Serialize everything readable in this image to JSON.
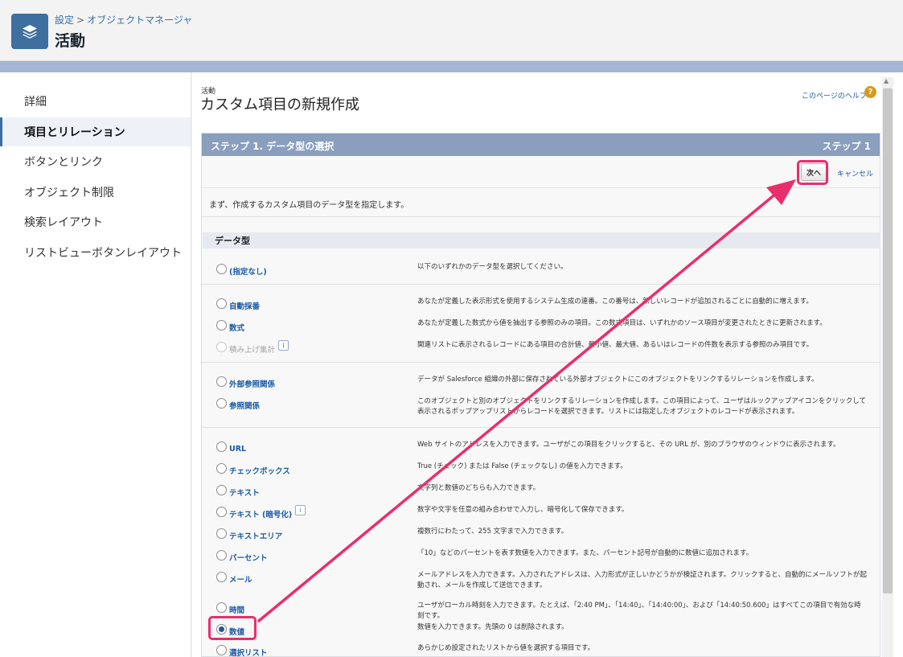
{
  "header": {
    "breadcrumb": [
      "設定",
      "オブジェクトマネージャ"
    ],
    "breadcrumb_separator": ">",
    "title": "活動",
    "icon": "layers-icon"
  },
  "sidebar": {
    "items": [
      {
        "label": "詳細",
        "active": false
      },
      {
        "label": "項目とリレーション",
        "active": true
      },
      {
        "label": "ボタンとリンク",
        "active": false
      },
      {
        "label": "オブジェクト制限",
        "active": false
      },
      {
        "label": "検索レイアウト",
        "active": false
      },
      {
        "label": "リストビューボタンレイアウト",
        "active": false
      }
    ]
  },
  "main": {
    "object_label": "活動",
    "page_title": "カスタム項目の新規作成",
    "help_link": "このページのヘルプ",
    "help_icon": "?",
    "step_title": "ステップ 1. データ型の選択",
    "step_number": "ステップ 1",
    "next_button": "次へ",
    "cancel_link": "キャンセル",
    "intro_text": "まず、作成するカスタム項目のデータ型を指定します。",
    "section_title": "データ型",
    "info_icon_label": "i",
    "options": [
      {
        "label": "(指定なし)",
        "description": "以下のいずれかのデータ型を選択してください。",
        "selected": false,
        "disabled": false,
        "info": false
      },
      {
        "label": "自動採番",
        "description": "あなたが定義した表示形式を使用するシステム生成の連番。この番号は、新しいレコードが追加されるごとに自動的に増えます。",
        "selected": false,
        "disabled": false,
        "info": false
      },
      {
        "label": "数式",
        "description": "あなたが定義した数式から値を抽出する参照のみの項目。この数式項目は、いずれかのソース項目が変更されたときに更新されます。",
        "selected": false,
        "disabled": false,
        "info": false
      },
      {
        "label": "積み上げ集計",
        "description": "関連リストに表示されるレコードにある項目の合計値、最小値、最大値、あるいはレコードの件数を表示する参照のみ項目です。",
        "selected": false,
        "disabled": true,
        "info": true
      },
      {
        "label": "外部参照関係",
        "description": "データが Salesforce 組織の外部に保存されている外部オブジェクトにこのオブジェクトをリンクするリレーションを作成します。",
        "selected": false,
        "disabled": false,
        "info": false
      },
      {
        "label": "参照関係",
        "description": "このオブジェクトと別のオブジェクトをリンクするリレーションを作成します。この項目によって、ユーザはルックアップアイコンをクリックして表示されるポップアップリストからレコードを選択できます。リストには指定したオブジェクトのレコードが表示されます。",
        "selected": false,
        "disabled": false,
        "info": false
      },
      {
        "label": "URL",
        "description": "Web サイトのアドレスを入力できます。ユーザがこの項目をクリックすると、その URL が、別のブラウザのウィンドウに表示されます。",
        "selected": false,
        "disabled": false,
        "info": false
      },
      {
        "label": "チェックボックス",
        "description": "True (チェック) または False (チェックなし) の値を入力できます。",
        "selected": false,
        "disabled": false,
        "info": false
      },
      {
        "label": "テキスト",
        "description": "文字列と数値のどちらも入力できます。",
        "selected": false,
        "disabled": false,
        "info": false
      },
      {
        "label": "テキスト (暗号化)",
        "description": "数字や文字を任意の組み合わせで入力し、暗号化して保存できます。",
        "selected": false,
        "disabled": false,
        "info": true
      },
      {
        "label": "テキストエリア",
        "description": "複数行にわたって、255 文字まで入力できます。",
        "selected": false,
        "disabled": false,
        "info": false
      },
      {
        "label": "パーセント",
        "description": "「10」などのパーセントを表す数値を入力できます。また、パーセント記号が自動的に数値に追加されます。",
        "selected": false,
        "disabled": false,
        "info": false
      },
      {
        "label": "メール",
        "description": "メールアドレスを入力できます。入力されたアドレスは、入力形式が正しいかどうかが検証されます。クリックすると、自動的にメールソフトが起動され、メールを作成して送信できます。",
        "selected": false,
        "disabled": false,
        "info": false
      },
      {
        "label": "時間",
        "description": "ユーザがローカル時刻を入力できます。たとえば、「2:40 PM」、「14:40」、「14:40:00」、および「14:40:50.600」はすべてこの項目で有効な時刻です。",
        "selected": false,
        "disabled": false,
        "info": false
      },
      {
        "label": "数値",
        "description": "数値を入力できます。先頭の 0 は削除されます。",
        "selected": true,
        "disabled": false,
        "info": false
      },
      {
        "label": "選択リスト",
        "description": "あらかじめ設定されたリストから値を選択する項目です。",
        "selected": false,
        "disabled": false,
        "info": false
      }
    ]
  },
  "colors": {
    "accent": "#3a6ea5",
    "step_bar": "#8a9ebe",
    "highlight": "#ea2e6b",
    "band": "#a3b6d3"
  }
}
